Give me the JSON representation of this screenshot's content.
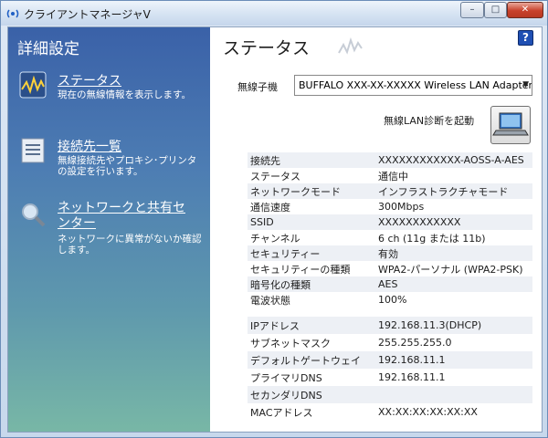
{
  "window": {
    "title": "クライアントマネージャV",
    "minimize": "–",
    "maximize": "□",
    "close": "✕"
  },
  "sidebar": {
    "title": "詳細設定",
    "items": [
      {
        "label": "ステータス",
        "desc": "現在の無線情報を表示します。",
        "icon": "status-wave-icon"
      },
      {
        "label": "接続先一覧",
        "desc": "無線接続先やプロキシ･プリンタの設定を行います。",
        "icon": "list-document-icon"
      },
      {
        "label": "ネットワークと共有センター",
        "desc": "ネットワークに異常がないか確認します。",
        "icon": "magnifier-icon"
      }
    ]
  },
  "main": {
    "title": "ステータス",
    "help": "?",
    "adapter_label": "無線子機",
    "adapter_value": "BUFFALO XXX-XX-XXXXX Wireless LAN Adapter",
    "diagnose_label": "無線LAN診断を起動",
    "wireless_info": [
      {
        "key": "接続先",
        "value": "XXXXXXXXXXXX-AOSS-A-AES"
      },
      {
        "key": "ステータス",
        "value": "通信中"
      },
      {
        "key": "ネットワークモード",
        "value": "インフラストラクチャモード"
      },
      {
        "key": "通信速度",
        "value": "300Mbps"
      },
      {
        "key": "SSID",
        "value": "XXXXXXXXXXXX"
      },
      {
        "key": "チャンネル",
        "value": "6 ch (11g または 11b)"
      },
      {
        "key": "セキュリティー",
        "value": "有効"
      },
      {
        "key": "セキュリティーの種類",
        "value": "WPA2-パーソナル (WPA2-PSK)"
      },
      {
        "key": "暗号化の種類",
        "value": "AES"
      },
      {
        "key": "電波状態",
        "value": "100%"
      }
    ],
    "ip_info": [
      {
        "key": "IPアドレス",
        "value": "192.168.11.3(DHCP)"
      },
      {
        "key": "サブネットマスク",
        "value": "255.255.255.0"
      },
      {
        "key": "デフォルトゲートウェイ",
        "value": "192.168.11.1"
      },
      {
        "key": "プライマリDNS",
        "value": "192.168.11.1"
      },
      {
        "key": "セカンダリDNS",
        "value": ""
      },
      {
        "key": "MACアドレス",
        "value": "XX:XX:XX:XX:XX:XX"
      }
    ]
  }
}
